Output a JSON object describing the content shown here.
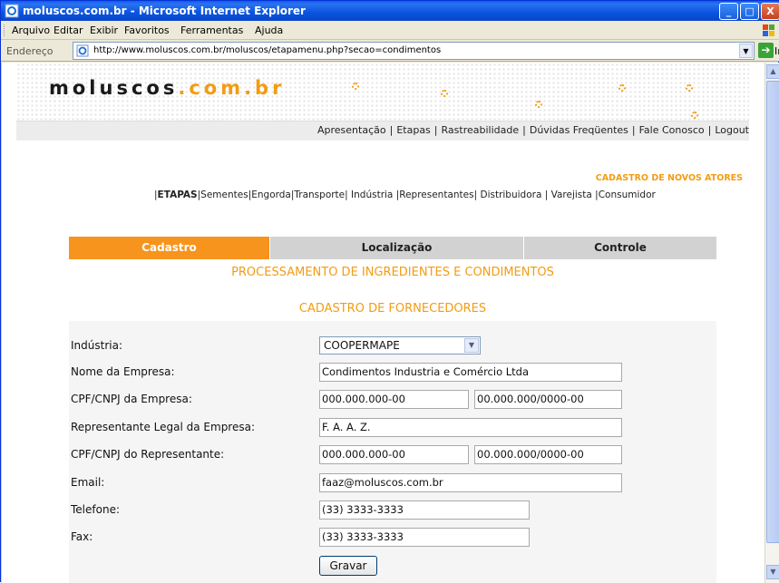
{
  "window": {
    "title": "moluscos.com.br - Microsoft Internet Explorer",
    "controls": {
      "minimize": "_",
      "maximize": "□",
      "close": "X"
    }
  },
  "menu": {
    "items": [
      "Arquivo",
      "Editar",
      "Exibir",
      "Favoritos",
      "Ferramentas",
      "Ajuda"
    ]
  },
  "address": {
    "label": "Endereço",
    "url": "http://www.moluscos.com.br/moluscos/etapamenu.php?secao=condimentos",
    "go_label": "Ir"
  },
  "site": {
    "logo_main": "moluscos",
    "logo_accent": ".com.br",
    "topnav": [
      "Apresentação",
      "Etapas",
      "Rastreabilidade",
      "Dúvidas Freqüentes",
      "Fale Conosco",
      "Logout"
    ],
    "section_title": "CADASTRO DE NOVOS ATORES",
    "steps": [
      "ETAPAS",
      "Sementes",
      "Engorda",
      "Transporte",
      "Indústria",
      "Representantes",
      "Distribuidora",
      "Varejista",
      "Consumidor"
    ]
  },
  "tabs": [
    {
      "label": "Cadastro",
      "active": true
    },
    {
      "label": "Localização",
      "active": false
    },
    {
      "label": "Controle",
      "active": false
    }
  ],
  "form": {
    "heading1": "PROCESSAMENTO DE INGREDIENTES E CONDIMENTOS",
    "heading2": "CADASTRO DE FORNECEDORES",
    "industria": {
      "label": "Indústria:",
      "value": "COOPERMAPE"
    },
    "nome_empresa": {
      "label": "Nome da Empresa:",
      "value": "Condimentos Industria e Comércio Ltda"
    },
    "cpf_empresa": {
      "label": "CPF/CNPJ da Empresa:",
      "cpf": "000.000.000-00",
      "cnpj": "00.000.000/0000-00"
    },
    "representante": {
      "label": "Representante Legal da Empresa:",
      "value": "F. A. A. Z."
    },
    "cpf_representante": {
      "label": "CPF/CNPJ do Representante:",
      "cpf": "000.000.000-00",
      "cnpj": "00.000.000/0000-00"
    },
    "email": {
      "label": "Email:",
      "value": "faaz@moluscos.com.br"
    },
    "telefone": {
      "label": "Telefone:",
      "value": "(33) 3333-3333"
    },
    "fax": {
      "label": "Fax:",
      "value": "(33) 3333-3333"
    },
    "submit_label": "Gravar"
  },
  "colors": {
    "accent": "#f39c12",
    "tab_active": "#f7941d",
    "tab_inactive": "#d2d2d2",
    "xp_blue": "#0a5ee8"
  }
}
